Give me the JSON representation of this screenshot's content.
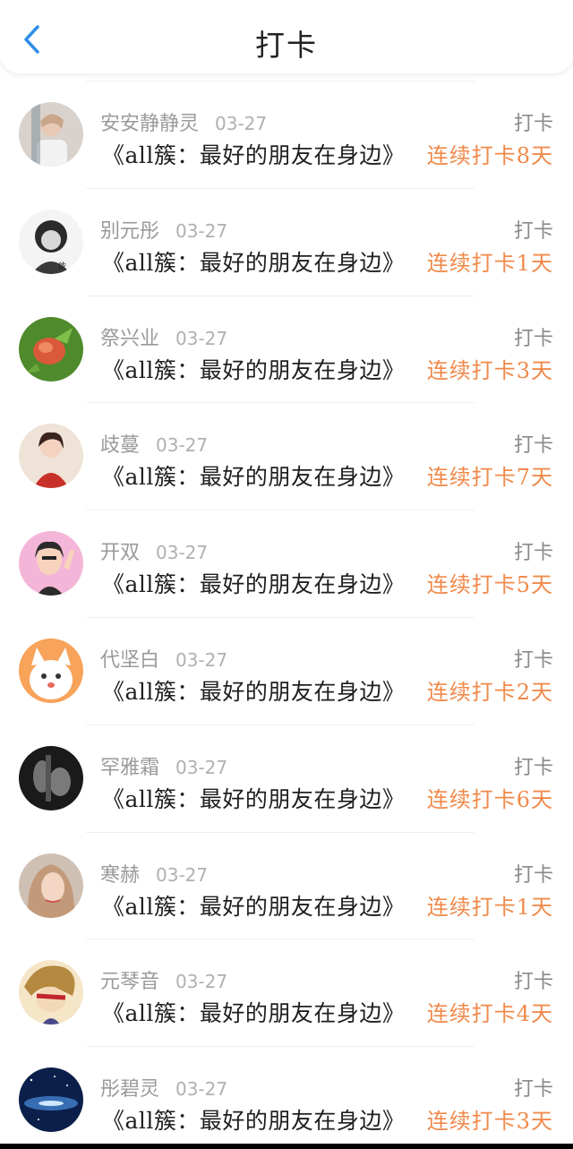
{
  "header": {
    "title": "打卡",
    "back_icon": "chevron-left-icon",
    "accent": "#2f8fe6"
  },
  "colors": {
    "streak": "#f08a4b"
  },
  "entries": [
    {
      "name": "安安静静灵",
      "date": "03-27",
      "action": "打卡",
      "content": "《all簇：最好的朋友在身边》",
      "streak": "连续打卡8天"
    },
    {
      "name": "别元彤",
      "date": "03-27",
      "action": "打卡",
      "content": "《all簇：最好的朋友在身边》",
      "streak": "连续打卡1天"
    },
    {
      "name": "祭兴业",
      "date": "03-27",
      "action": "打卡",
      "content": "《all簇：最好的朋友在身边》",
      "streak": "连续打卡3天"
    },
    {
      "name": "歧蔓",
      "date": "03-27",
      "action": "打卡",
      "content": "《all簇：最好的朋友在身边》",
      "streak": "连续打卡7天"
    },
    {
      "name": "开双",
      "date": "03-27",
      "action": "打卡",
      "content": "《all簇：最好的朋友在身边》",
      "streak": "连续打卡5天"
    },
    {
      "name": "代坚白",
      "date": "03-27",
      "action": "打卡",
      "content": "《all簇：最好的朋友在身边》",
      "streak": "连续打卡2天"
    },
    {
      "name": "罕雅霜",
      "date": "03-27",
      "action": "打卡",
      "content": "《all簇：最好的朋友在身边》",
      "streak": "连续打卡6天"
    },
    {
      "name": "寒赫",
      "date": "03-27",
      "action": "打卡",
      "content": "《all簇：最好的朋友在身边》",
      "streak": "连续打卡1天"
    },
    {
      "name": "元琴音",
      "date": "03-27",
      "action": "打卡",
      "content": "《all簇：最好的朋友在身边》",
      "streak": "连续打卡4天"
    },
    {
      "name": "彤碧灵",
      "date": "03-27",
      "action": "打卡",
      "content": "《all簇：最好的朋友在身边》",
      "streak": "连续打卡3天"
    }
  ]
}
